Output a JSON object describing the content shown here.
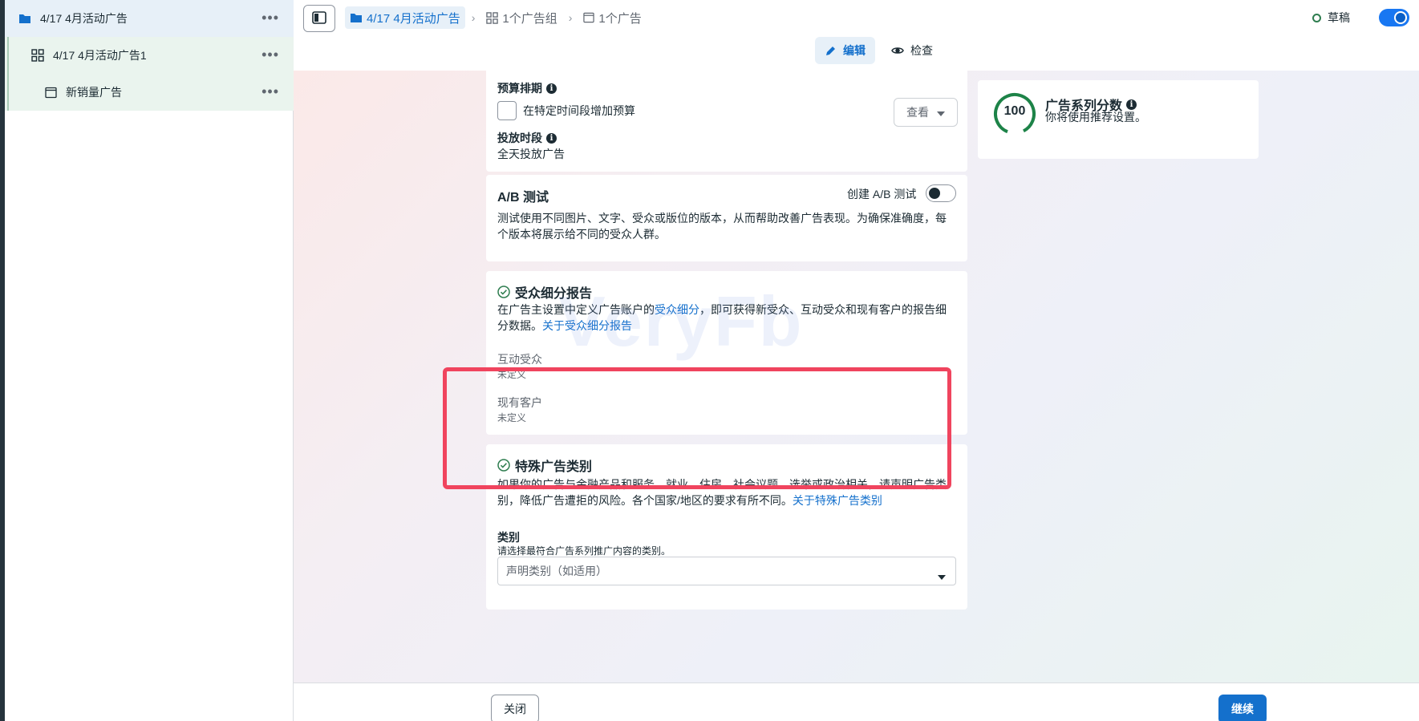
{
  "sidebar": {
    "items": [
      {
        "label": "4/17 4月活动广告",
        "icon": "folder-icon"
      },
      {
        "label": "4/17 4月活动广告1",
        "icon": "grid-icon"
      },
      {
        "label": "新销量广告",
        "icon": "ad-window-icon"
      }
    ],
    "more_label": "•••"
  },
  "topbar": {
    "breadcrumbs": [
      {
        "label": "4/17 4月活动广告",
        "icon": "folder-icon"
      },
      {
        "label": "1个广告组",
        "icon": "grid-icon"
      },
      {
        "label": "1个广告",
        "icon": "ad-window-icon"
      }
    ],
    "status": "草稿",
    "tabs": [
      {
        "label": "编辑",
        "icon": "pencil-icon"
      },
      {
        "label": "检查",
        "icon": "eye-icon"
      }
    ]
  },
  "budget_card": {
    "schedule_title": "预算排期",
    "increase_label": "在特定时间段增加预算",
    "view_label": "查看",
    "delivery_title": "投放时段",
    "delivery_value": "全天投放广告"
  },
  "score_card": {
    "score": "100",
    "title": "广告系列分数",
    "subtitle": "你将使用推荐设置。"
  },
  "ab_card": {
    "title": "A/B 测试",
    "toggle_label": "创建 A/B 测试",
    "description": "测试使用不同图片、文字、受众或版位的版本，从而帮助改善广告表现。为确保准确度，每个版本将展示给不同的受众人群。"
  },
  "audience_card": {
    "title": "受众细分报告",
    "desc_before": "在广告主设置中定义广告账户的",
    "desc_link": "受众细分",
    "desc_after": "，即可获得新受众、互动受众和现有客户的报告细分数据。",
    "about_link": "关于受众细分报告",
    "rows": [
      {
        "label": "互动受众",
        "value": "未定义"
      },
      {
        "label": "现有客户",
        "value": "未定义"
      }
    ]
  },
  "special_card": {
    "title": "特殊广告类别",
    "description": "如果你的广告与金融产品和服务、就业、住房、社会议题、选举或政治相关，请声明广告类别，降低广告遭拒的风险。各个国家/地区的要求有所不同。",
    "about_link": "关于特殊广告类别",
    "category_label": "类别",
    "category_hint": "请选择最符合广告系列推广内容的类别。",
    "category_placeholder": "声明类别（如适用）"
  },
  "watermark": "VeryFb",
  "footer": {
    "close_label": "关闭",
    "continue_label": "继续"
  },
  "colors": {
    "accent": "#1470cc",
    "highlight": "#f0445e",
    "success": "#2e7d4f"
  }
}
